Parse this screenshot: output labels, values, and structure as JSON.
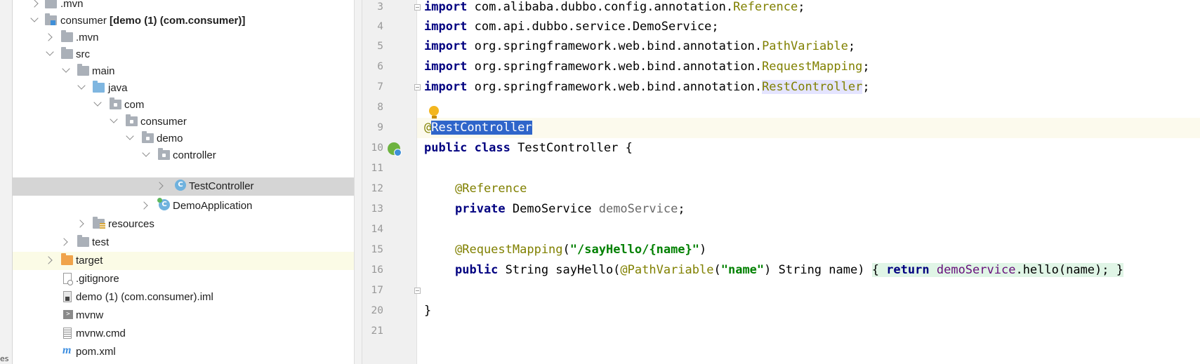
{
  "side_tab": {
    "label": "es"
  },
  "project_tree": {
    "rows": [
      {
        "label": ".mvn"
      },
      {
        "label": "consumer",
        "bold": "[demo (1) (com.consumer)]"
      },
      {
        "label": ".mvn"
      },
      {
        "label": "src"
      },
      {
        "label": "main"
      },
      {
        "label": "java"
      },
      {
        "label": "com"
      },
      {
        "label": "consumer"
      },
      {
        "label": "demo"
      },
      {
        "label": "controller"
      },
      {
        "label": "TestController",
        "badge": "C"
      },
      {
        "label": "DemoApplication",
        "badge": "C"
      },
      {
        "label": "resources"
      },
      {
        "label": "test"
      },
      {
        "label": "target"
      },
      {
        "label": ".gitignore"
      },
      {
        "label": "demo (1) (com.consumer).iml"
      },
      {
        "label": "mvnw",
        "badge": ">"
      },
      {
        "label": "mvnw.cmd"
      },
      {
        "label": "pom.xml",
        "badge": "m"
      }
    ]
  },
  "editor": {
    "line_numbers": [
      "3",
      "4",
      "5",
      "6",
      "7",
      "8",
      "9",
      "10",
      "11",
      "12",
      "13",
      "14",
      "15",
      "16",
      "17",
      "20",
      "21"
    ],
    "lines": {
      "l3": [
        "import",
        " com.alibaba.dubbo.config.annotation.",
        "Reference",
        ";"
      ],
      "l4": [
        "import",
        " com.api.dubbo.service.DemoService;"
      ],
      "l5": [
        "import",
        " org.springframework.web.bind.annotation.",
        "PathVariable",
        ";"
      ],
      "l6": [
        "import",
        " org.springframework.web.bind.annotation.",
        "RequestMapping",
        ";"
      ],
      "l7": [
        "import",
        " org.springframework.web.bind.annotation.",
        "RestController",
        ";"
      ],
      "l9": [
        "@",
        "RestController"
      ],
      "l10": [
        "public",
        " ",
        "class",
        " TestController {"
      ],
      "l12": [
        "@Reference"
      ],
      "l13": [
        "private",
        " DemoService ",
        "demoService",
        ";"
      ],
      "l16": [
        "@RequestMapping",
        "(",
        "\"/sayHello/{name}\"",
        ")"
      ],
      "l17": [
        "public",
        " String sayHello(",
        "@PathVariable",
        "(",
        "\"name\"",
        ") String name) ",
        "{",
        " ",
        "return",
        " ",
        "demoService",
        ".hello(name); ",
        "}"
      ],
      "l20": [
        "}"
      ]
    }
  },
  "colors": {
    "keyword": "#000080",
    "annotation": "#808000",
    "string": "#008000",
    "field": "#660e7a",
    "selection": "#2f65ca"
  },
  "icons": {
    "intention": "lightbulb-icon",
    "gutter": "spring-bean-icon"
  }
}
